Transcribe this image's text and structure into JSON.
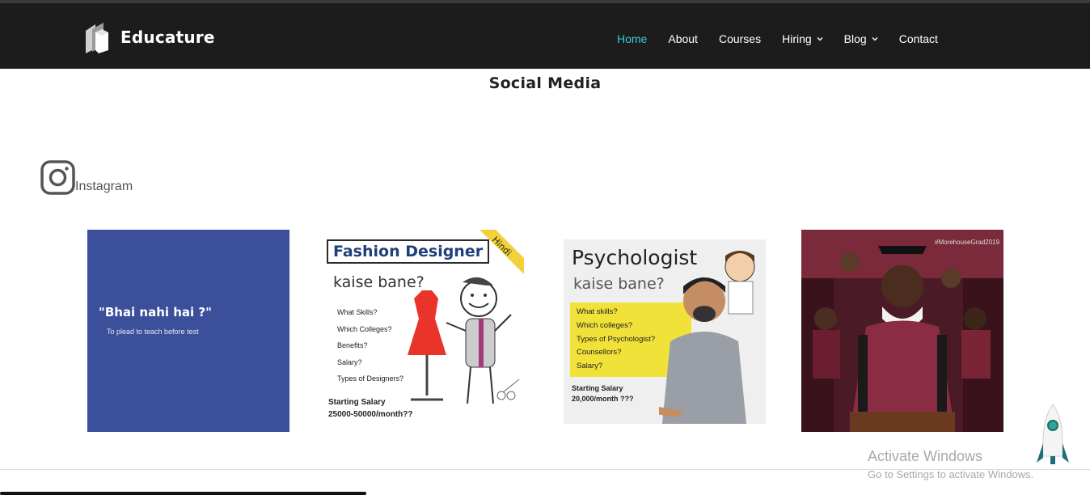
{
  "brand": {
    "name": "Educature",
    "logo_icon": "book-logo-icon"
  },
  "nav": {
    "items": [
      {
        "label": "Home",
        "active": true
      },
      {
        "label": "About"
      },
      {
        "label": "Courses"
      },
      {
        "label": "Hiring",
        "has_dropdown": true
      },
      {
        "label": "Blog",
        "has_dropdown": true
      },
      {
        "label": "Contact"
      }
    ]
  },
  "page": {
    "section_title": "Social Media"
  },
  "instagram": {
    "label": "Instagram",
    "icon": "instagram-icon"
  },
  "posts": [
    {
      "quote": "\"Bhai nahi hai ?\"",
      "subtitle": "To plead to teach before test",
      "color": "#3b4f9a"
    },
    {
      "title": "Fashion Designer",
      "ribbon": "Hindi",
      "subtitle": "kaise bane?",
      "list": [
        "What Skills?",
        "Which Colleges?",
        "Benefits?",
        "Salary?",
        "Types of Designers?"
      ],
      "salary_line1": "Starting Salary",
      "salary_line2": "25000-50000/month??"
    },
    {
      "title": "Psychologist",
      "subtitle": "kaise bane?",
      "list": [
        "What skills?",
        "Which colleges?",
        "Types of Psychologist?",
        "Counsellors?",
        "Salary?"
      ],
      "salary_line1": "Starting Salary",
      "salary_line2": "20,000/month ???"
    },
    {
      "caption": "#MorehouseGrad2019"
    }
  ],
  "watermark": {
    "title": "Activate Windows",
    "subtitle": "Go to Settings to activate Windows."
  },
  "colors": {
    "nav_bg": "#1c1c1c",
    "accent": "#3ec6d6"
  }
}
